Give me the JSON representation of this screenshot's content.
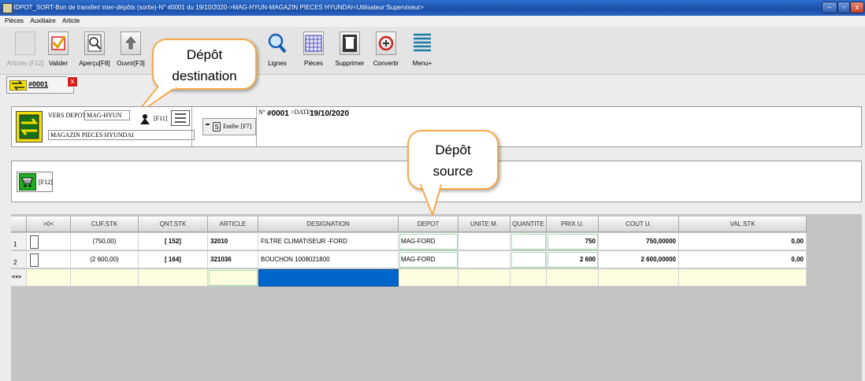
{
  "window": {
    "title": "IDPOT_SORT-Bon de transfert inter-dépôts (sortie)-N° #0001 du 19/10/2020->MAG-HYUN-MAGAZIN PIECES HYUNDAI<Utilisateur:Superviseur>",
    "minimize": "–",
    "restore": "▫",
    "close": "x"
  },
  "menu": [
    "Pièces",
    "Auxiliaire",
    "Article"
  ],
  "toolbar": [
    {
      "label": "Articles [F12]"
    },
    {
      "label": "Valider"
    },
    {
      "label": "Aperçu[F8]"
    },
    {
      "label": "Ouvrir[F3]"
    },
    {
      "label": "Lignes"
    },
    {
      "label": "Pièces"
    },
    {
      "label": "Supprimer"
    },
    {
      "label": "Convertir"
    },
    {
      "label": "Menu+"
    }
  ],
  "callouts": {
    "destination": [
      "Dépôt",
      "destination"
    ],
    "source": [
      "Dépôt",
      "source"
    ]
  },
  "doc_tab": {
    "label": "#0001",
    "close": "x"
  },
  "header": {
    "vers_depot_label": "VERS DEPOT",
    "vers_depot_value": "MAG-HYUN",
    "depot_name": "MAGAZIN PIECES HYUNDAI",
    "f11": "[F11]",
    "entete_icon": "S",
    "entete_label": "Entête [F7]",
    "num_label": "N°",
    "num_value": "#0001",
    "date_label": ">DATE :",
    "date_value": "19/10/2020"
  },
  "section2": {
    "f12": "[F12]"
  },
  "table": {
    "columns": [
      ">0<",
      "CUF.STK",
      "QNT.STK",
      "ARTICLE",
      "DESIGNATION",
      "DEPOT",
      "UNITE M.",
      "QUANTITE",
      "PRIX U.",
      "COUT U.",
      "VAL.STK"
    ],
    "rows": [
      {
        "num": "1",
        "cuf": "(750,00)",
        "qnt": "[ 152]",
        "article": "32010",
        "designation": "FILTRE CLIMATISEUR -FORD",
        "depot": "MAG-FORD",
        "unite": "",
        "quantite": "",
        "prix": "750",
        "cout": "750,00000",
        "val": "0,00"
      },
      {
        "num": "2",
        "cuf": "(2 600,00)",
        "qnt": "[ 164]",
        "article": "321036",
        "designation": "BOUCHON 1008021800",
        "depot": "MAG-FORD",
        "unite": "",
        "quantite": "",
        "prix": "2 600",
        "cout": "2 600,00000",
        "val": "0,00"
      }
    ],
    "new_row_marker": "<+>"
  },
  "colors": {
    "titlebar": "#1a4fa8",
    "callout_border": "#f6a94a",
    "selection": "#0066cc",
    "new_row": "#fffde0",
    "field_highlight": "#9fdcaf"
  }
}
